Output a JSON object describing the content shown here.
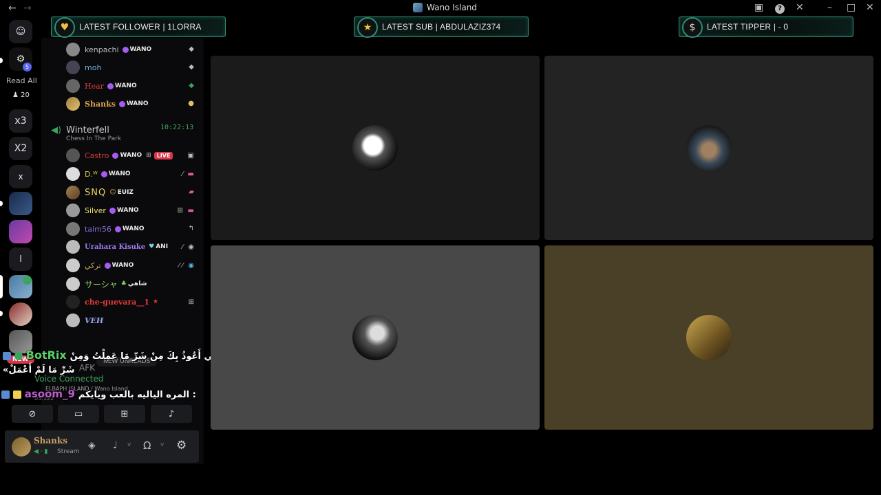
{
  "window": {
    "title": "Wano Island"
  },
  "banners": {
    "follower": "LATEST FOLLOWER | 1LORRA",
    "sub": "LATEST SUB | ABDULAZIZ374",
    "tipper": "LATEST TIPPER |  - 0"
  },
  "rail": {
    "badge_count": "5",
    "read_all": "Read All",
    "members_count": "20",
    "x3": "x3",
    "x2": "X2",
    "x": "x",
    "l": "l"
  },
  "sidebar": {
    "members_top": [
      {
        "name": "kenpachi",
        "color": "#b9bbbe",
        "tag": "WANO"
      },
      {
        "name": "moh",
        "color": "#6fb3d8",
        "tag": ""
      },
      {
        "name": "Hear",
        "color": "#d63a3a",
        "tag": "WANO"
      },
      {
        "name": "Shanks",
        "color": "#e0a64a",
        "tag": "WANO"
      }
    ],
    "channel": {
      "name": "Winterfell",
      "time": "10:22:13",
      "activity": "Chess In The Park"
    },
    "members": [
      {
        "name": "Castro",
        "color": "#d63a3a",
        "tag": "WANO",
        "live": "LIVE"
      },
      {
        "name": "D.ᵂ",
        "color": "#e0c64a",
        "tag": "WANO"
      },
      {
        "name": "SNQ",
        "color": "#e9d25a",
        "tag": "EUIZ"
      },
      {
        "name": "Silver",
        "color": "#f0e060",
        "tag": "WANO"
      },
      {
        "name": "taim56",
        "color": "#8a6cd8",
        "tag": "WANO"
      },
      {
        "name": "Urahara Kisuke",
        "color": "#9c7cf0",
        "tag": "ANI"
      },
      {
        "name": "تركي",
        "color": "#c8a860",
        "tag": "WANO"
      },
      {
        "name": "サーシャ",
        "color": "#8ad06a",
        "tag": "شاهي"
      },
      {
        "name": "che-guevara__1",
        "color": "#e23a3a",
        "tag": "★"
      },
      {
        "name": "VEH",
        "color": "#9aa6f0",
        "tag": ""
      }
    ],
    "afk": "AFK",
    "new_badge": "NEW",
    "new_unreads": "NEW UNREADS",
    "voice_connected": "Voice Connected",
    "voice_location": "ELBAPH ISLAND / Wano Island",
    "ping": "05:122"
  },
  "chat_overlay": [
    {
      "user": "BotRix",
      "text": "اللَّهُمَّ إِنِّي أَعُوذُ بِكَ مِنْ شَرِّ مَا عَمِلْتُ وَمِنْ» :",
      "cont": "«شَرِّ مَا لَمْ أَعْمَلْ"
    },
    {
      "user": "asoom_9",
      "text": "المره الياليه بالعب ويايكم :"
    }
  ],
  "user_panel": {
    "name": "Shanks",
    "status": "Stream"
  },
  "colors": {
    "accent": "#2f8f78",
    "live": "#d8364a",
    "voice_green": "#3ba55d"
  }
}
